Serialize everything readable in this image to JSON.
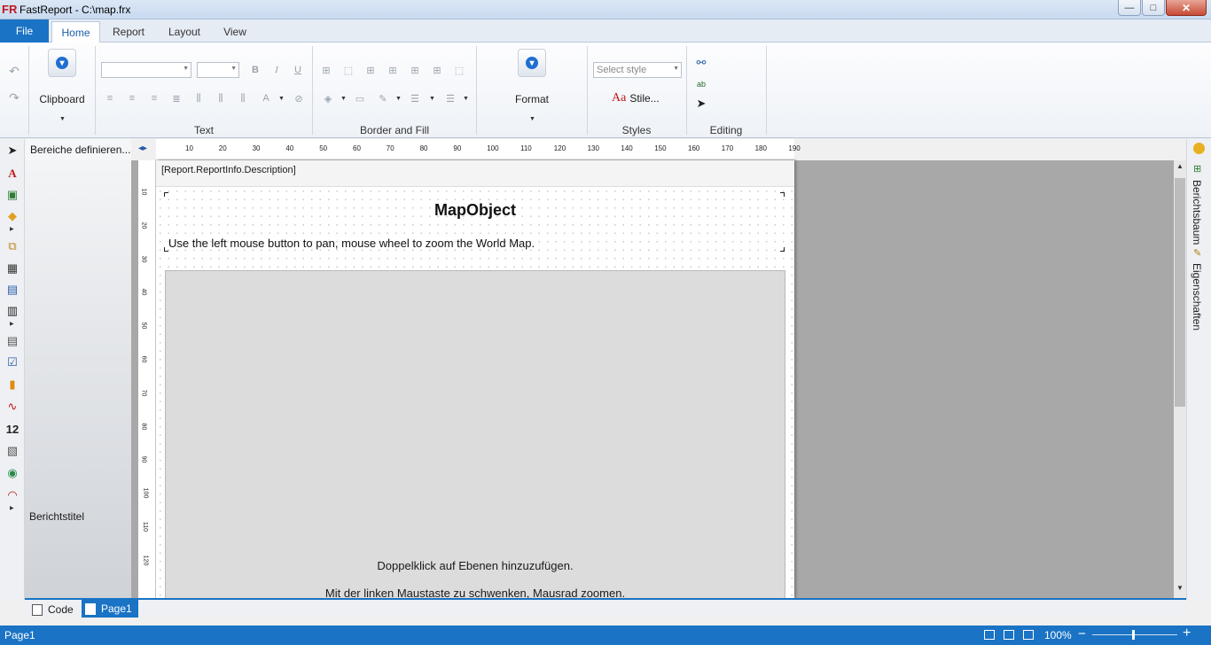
{
  "window": {
    "title": "FastReport - C:\\map.frx",
    "logo": "FR",
    "minimize": "—",
    "maximize": "□",
    "close": "✕"
  },
  "ribbon_tabs": {
    "file": "File",
    "home": "Home",
    "report": "Report",
    "layout": "Layout",
    "view": "View"
  },
  "ribbon_groups": {
    "clipboard": "Clipboard",
    "text": "Text",
    "border_fill": "Border and Fill",
    "format": "Format",
    "styles": "Styles",
    "editing": "Editing"
  },
  "styles": {
    "select_placeholder": "Select style",
    "stile_button": "Stile..."
  },
  "band_panel": {
    "header": "Bereiche definieren...",
    "report_title": "Berichtstitel"
  },
  "ruler": {
    "h_labels": [
      "10",
      "20",
      "30",
      "40",
      "50",
      "60",
      "70",
      "80",
      "90",
      "100",
      "110",
      "120",
      "130",
      "140",
      "150",
      "160",
      "170",
      "180",
      "190"
    ],
    "v_labels": [
      "10",
      "20",
      "30",
      "40",
      "50",
      "60",
      "70",
      "80",
      "90",
      "100",
      "110",
      "120"
    ]
  },
  "page": {
    "description_band": "[Report.ReportInfo.Description]",
    "map_heading": "MapObject",
    "map_subtitle": "Use the left mouse button to pan, mouse wheel to zoom the World Map.",
    "map_hint_1": "Doppelklick auf Ebenen hinzuzufügen.",
    "map_hint_2": "Mit der linken Maustaste zu schwenken, Mausrad zoomen."
  },
  "side_tabs": {
    "tree": "Berichtsbaum",
    "properties": "Eigenschaften"
  },
  "page_tabs": {
    "code": "Code",
    "page1": "Page1"
  },
  "status": {
    "page": "Page1",
    "zoom": "100%",
    "zoom_level": 0.48
  },
  "colors": {
    "accent": "#1a73c4",
    "close_button": "#c74a36"
  }
}
